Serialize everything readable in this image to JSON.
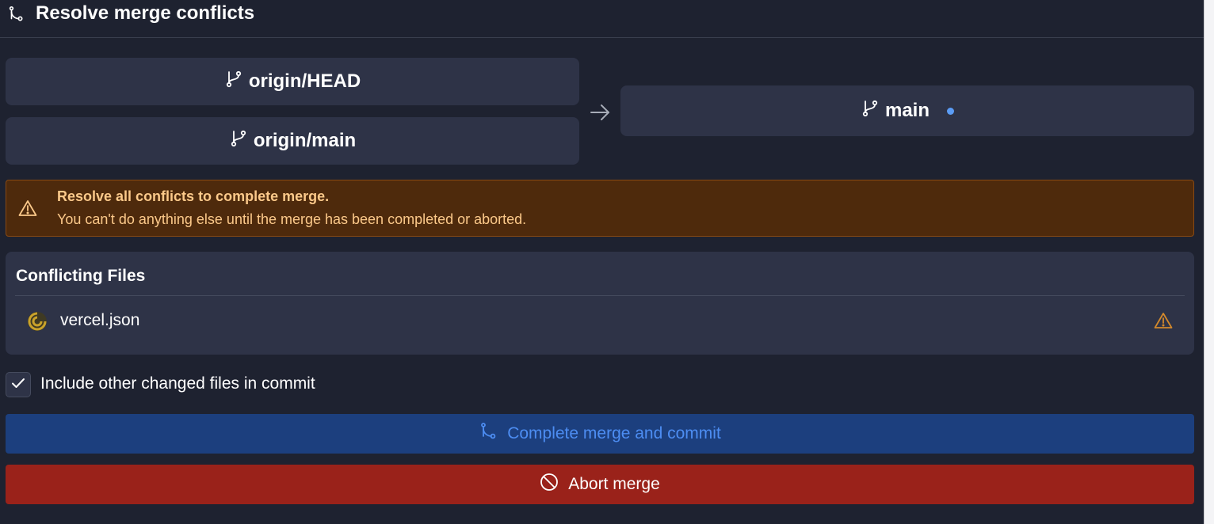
{
  "header": {
    "title": "Resolve merge conflicts",
    "icon": "git-merge-icon"
  },
  "merge": {
    "sources": [
      {
        "label": "origin/HEAD",
        "icon": "git-branch-icon"
      },
      {
        "label": "origin/main",
        "icon": "git-branch-icon"
      }
    ],
    "arrow_icon": "arrow-right-icon",
    "target": {
      "label": "main",
      "icon": "git-branch-icon",
      "indicator_color": "#5b9cf5"
    }
  },
  "warning": {
    "icon": "warning-icon",
    "title": "Resolve all conflicts to complete merge.",
    "message": "You can't do anything else until the merge has been completed or aborted."
  },
  "conflicting_files": {
    "title": "Conflicting Files",
    "files": [
      {
        "name": "vercel.json",
        "icon": "json-file-icon",
        "status_icon": "warning-icon"
      }
    ]
  },
  "include_other": {
    "label": "Include other changed files in commit",
    "checked": true
  },
  "buttons": {
    "complete_label": "Complete merge and commit",
    "abort_label": "Abort merge"
  },
  "colors": {
    "background": "#1e2230",
    "card": "#2e3347",
    "warning_bg": "#4e2a0c",
    "warning_text": "#fcc98a",
    "complete_bg": "#1c3f7e",
    "complete_text": "#4d8df2",
    "abort_bg": "#9a221a"
  }
}
